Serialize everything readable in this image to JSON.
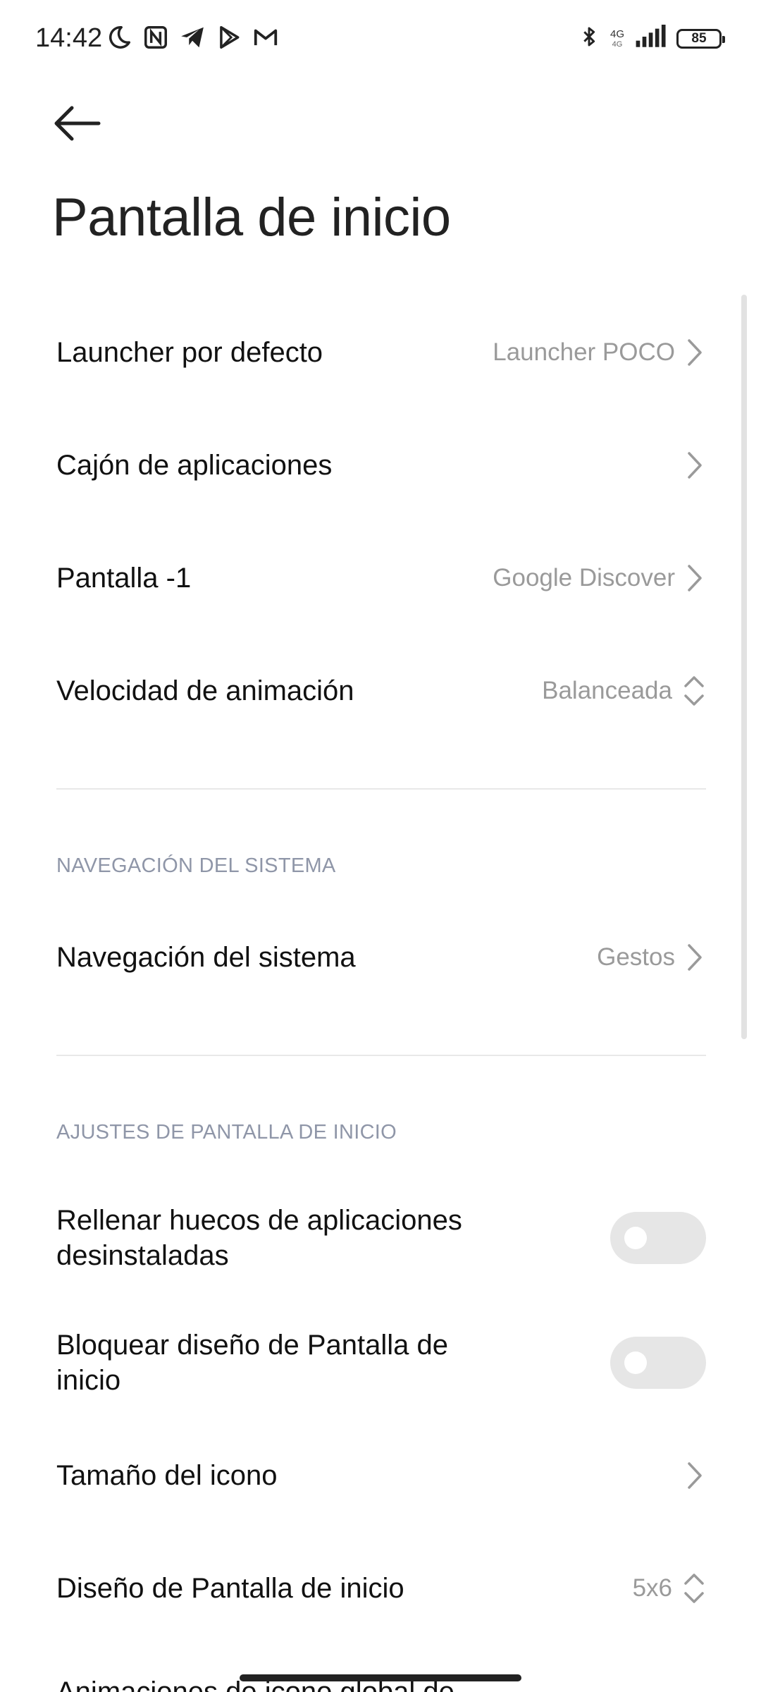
{
  "status_bar": {
    "time": "14:42",
    "network_top": "4G",
    "network_bottom": "4G",
    "battery": "85"
  },
  "header": {
    "title": "Pantalla de inicio"
  },
  "items": {
    "launcher": {
      "label": "Launcher por defecto",
      "value": "Launcher POCO"
    },
    "app_drawer": {
      "label": "Cajón de aplicaciones"
    },
    "screen_minus_one": {
      "label": "Pantalla -1",
      "value": "Google Discover"
    },
    "animation_speed": {
      "label": "Velocidad de animación",
      "value": "Balanceada"
    }
  },
  "section_nav": {
    "header": "NAVEGACIÓN DEL SISTEMA",
    "system_navigation": {
      "label": "Navegación del sistema",
      "value": "Gestos"
    }
  },
  "section_home": {
    "header": "AJUSTES DE PANTALLA DE INICIO",
    "fill_gaps": {
      "label": "Rellenar huecos de aplicaciones desinstaladas",
      "enabled": false
    },
    "lock_layout": {
      "label": "Bloquear diseño de Pantalla de inicio",
      "enabled": false
    },
    "icon_size": {
      "label": "Tamaño del icono"
    },
    "layout": {
      "label": "Diseño de Pantalla de inicio",
      "value": "5x6"
    },
    "partial_item": {
      "label": "Animaciones de icono global de"
    }
  },
  "colors": {
    "section_header": "#8f96a8",
    "secondary_text": "#9a9a9a",
    "toggle_off": "#e6e6e6"
  }
}
